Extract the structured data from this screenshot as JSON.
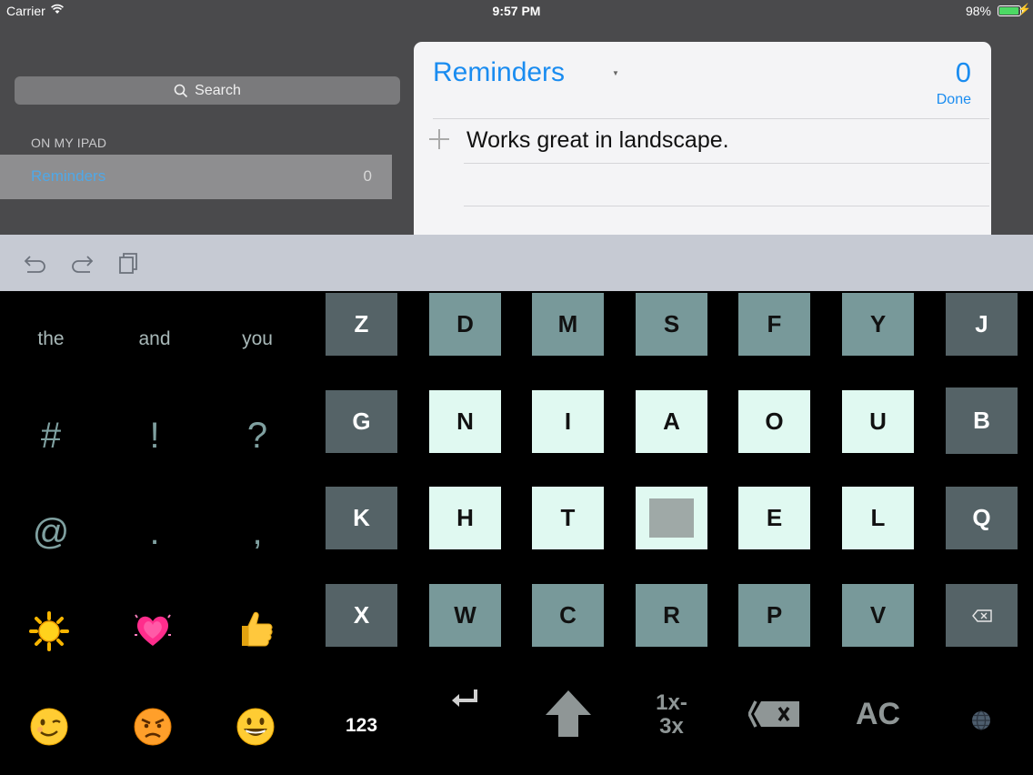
{
  "status_bar": {
    "carrier": "Carrier",
    "time": "9:57 PM",
    "battery": "98%"
  },
  "sidebar": {
    "search_label": "Search",
    "section_header": "ON MY IPAD",
    "lists": [
      {
        "label": "Reminders",
        "count": "0"
      }
    ]
  },
  "reminder_card": {
    "title": "Reminders",
    "count": "0",
    "done_label": "Done",
    "items": [
      "Works great in landscape."
    ]
  },
  "toolbar": {
    "icons": [
      "undo-icon",
      "redo-icon",
      "paste-icon"
    ]
  },
  "keyboard": {
    "suggestions": [
      "the",
      "and",
      "you"
    ],
    "symbols": [
      "#",
      "!",
      "?",
      "@",
      ".",
      ","
    ],
    "emoji": [
      "sun-emoji",
      "sparkling-heart-emoji",
      "thumbs-up-emoji",
      "winking-face-emoji",
      "angry-face-emoji",
      "grinning-face-emoji"
    ],
    "rows": [
      [
        "Z",
        "D",
        "M",
        "S",
        "F",
        "Y",
        "J"
      ],
      [
        "G",
        "N",
        "I",
        "A",
        "O",
        "U",
        "B"
      ],
      [
        "K",
        "H",
        "T",
        "",
        "E",
        "L",
        "Q"
      ],
      [
        "X",
        "W",
        "C",
        "R",
        "P",
        "V",
        ""
      ]
    ],
    "function_keys": {
      "numbers_label": "123",
      "multiplier_top": "1x-",
      "multiplier_bottom": "3x",
      "clear_label": "AC"
    },
    "colors": {
      "dark_key": "#556367",
      "teal_key": "#78999a",
      "light_key": "#e0f9f1",
      "accent": "#1a8cf0"
    }
  }
}
